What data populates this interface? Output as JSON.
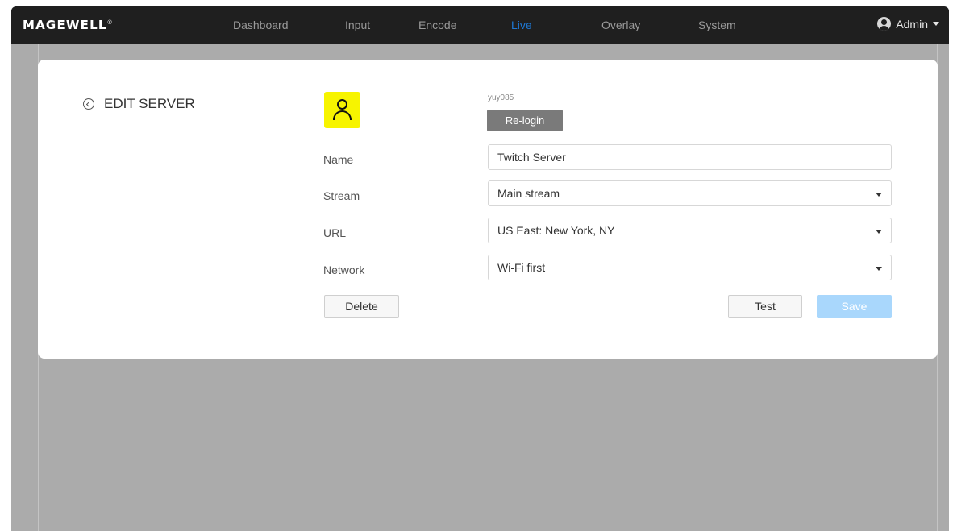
{
  "navbar": {
    "logo": "MAGEWELL",
    "logo_mark": "®",
    "items": [
      {
        "label": "Dashboard"
      },
      {
        "label": "Input"
      },
      {
        "label": "Encode"
      },
      {
        "label": "Live"
      },
      {
        "label": "Overlay"
      },
      {
        "label": "System"
      }
    ],
    "active_item": "Live",
    "user": "Admin"
  },
  "page": {
    "title": "EDIT SERVER"
  },
  "account": {
    "name": "yuy085",
    "relogin_label": "Re-login"
  },
  "form": {
    "name_label": "Name",
    "name_value": "Twitch Server",
    "stream_label": "Stream",
    "stream_value": "Main stream",
    "url_label": "URL",
    "url_value": "US East: New York, NY",
    "network_label": "Network",
    "network_value": "Wi-Fi first"
  },
  "actions": {
    "delete_label": "Delete",
    "test_label": "Test",
    "save_label": "Save"
  },
  "colors": {
    "navbar_bg": "#1f1f1f",
    "active_nav": "#1e78d4",
    "avatar_bg": "#f7f400",
    "save_button_bg": "#a9d7fc",
    "overlay_bg": "#ababab"
  }
}
